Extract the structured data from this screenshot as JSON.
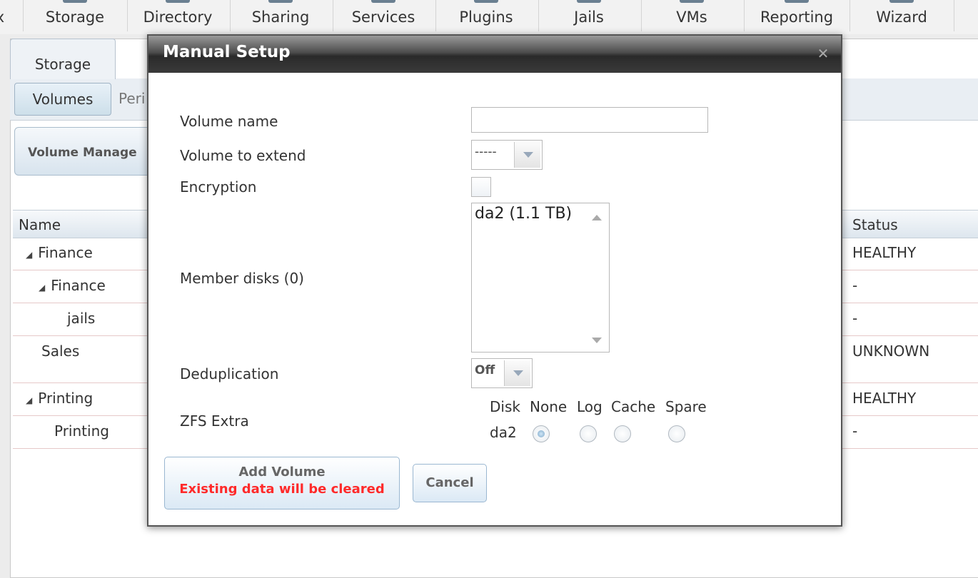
{
  "nav": {
    "items": [
      {
        "label": "Storage"
      },
      {
        "label": "Directory"
      },
      {
        "label": "Sharing"
      },
      {
        "label": "Services"
      },
      {
        "label": "Plugins"
      },
      {
        "label": "Jails"
      },
      {
        "label": "VMs"
      },
      {
        "label": "Reporting"
      },
      {
        "label": "Wizard"
      }
    ],
    "partial_left": "x"
  },
  "background": {
    "tab_label": "Storage",
    "volumes_button": "Volumes",
    "peri_label": "Peri",
    "volume_manager_button": "Volume Manage",
    "columns": {
      "name": "Name",
      "status": "Status"
    },
    "rows": [
      {
        "name": "Finance",
        "status": "HEALTHY"
      },
      {
        "name": "Finance",
        "status": "-"
      },
      {
        "name": "jails",
        "status": "-"
      },
      {
        "name": "Sales",
        "status": "UNKNOWN"
      },
      {
        "name": "Printing",
        "status": "HEALTHY"
      },
      {
        "name": "Printing",
        "status": "-"
      }
    ]
  },
  "dialog": {
    "title": "Manual Setup",
    "close_icon": "close-icon",
    "fields": {
      "volume_name_label": "Volume name",
      "volume_name_value": "",
      "volume_extend_label": "Volume to extend",
      "volume_extend_value": "-----",
      "encryption_label": "Encryption",
      "encryption_checked": false,
      "member_disks_label": "Member disks (0)",
      "member_disks_options": [
        "da2 (1.1 TB)"
      ],
      "dedup_label": "Deduplication",
      "dedup_value": "Off",
      "zfs_extra_label": "ZFS Extra"
    },
    "zfs_extra": {
      "headers": [
        "Disk",
        "None",
        "Log",
        "Cache",
        "Spare"
      ],
      "disk": "da2",
      "selected": "None"
    },
    "buttons": {
      "add_line1": "Add Volume",
      "add_line2": "Existing data will be cleared",
      "cancel": "Cancel"
    },
    "colors": {
      "warning": "#ff2a2a",
      "titlebar": "#3a3a3a"
    }
  }
}
